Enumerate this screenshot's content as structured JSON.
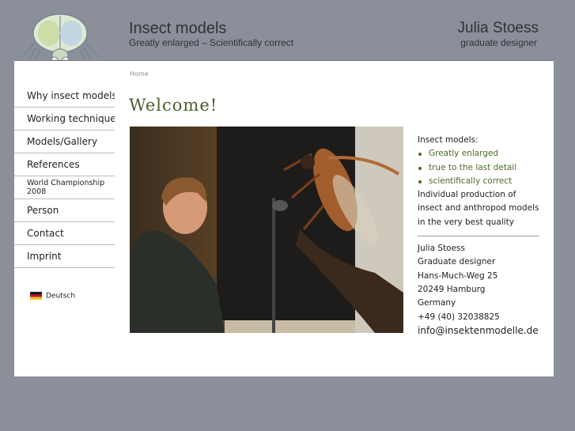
{
  "header": {
    "site_title": "Insect models",
    "site_subtitle": "Greatly enlarged – Scientifically correct",
    "author_name": "Julia Stoess",
    "author_role": "graduate designer"
  },
  "nav": {
    "items": [
      {
        "label": "Why insect models?"
      },
      {
        "label": "Working technique"
      },
      {
        "label": "Models/Gallery"
      },
      {
        "label": "References"
      },
      {
        "label": "World Championship 2008"
      },
      {
        "label": "Person"
      },
      {
        "label": "Contact"
      },
      {
        "label": "Imprint"
      }
    ],
    "language": "Deutsch"
  },
  "main": {
    "breadcrumb": "Home",
    "heading": "Welcome!",
    "intro": "Insect models:",
    "bullets": [
      "Greatly enlarged",
      "true to the last detail",
      "scientifically correct"
    ],
    "description": "Individual production of insect and anthropod models in the very best quality",
    "contact": {
      "name": "Julia Stoess",
      "role": "Graduate designer",
      "street": "Hans-Much-Weg 25",
      "city": "20249 Hamburg",
      "country": "Germany",
      "phone": "+49 (40) 32038825",
      "email": "info@insektenmodelle.de"
    }
  },
  "colors": {
    "background": "#8b8f99",
    "accent_green": "#4e6a27",
    "heading_green": "#4a5e2d"
  }
}
